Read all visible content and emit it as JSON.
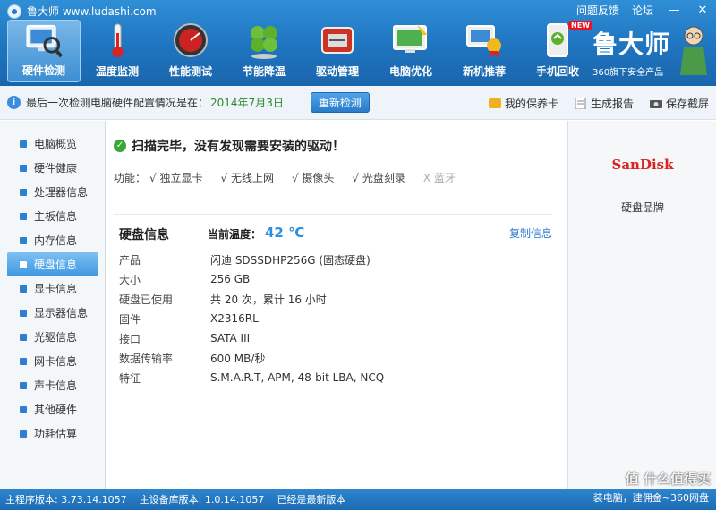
{
  "window": {
    "title": "鲁大师 www.ludashi.com",
    "top_links": [
      "问题反馈",
      "论坛"
    ],
    "min_label": "—",
    "close_label": "✕"
  },
  "toolbar": {
    "items": [
      {
        "label": "硬件检测",
        "icon": "monitor-magnifier-icon"
      },
      {
        "label": "温度监测",
        "icon": "thermometer-icon"
      },
      {
        "label": "性能测试",
        "icon": "speedometer-icon"
      },
      {
        "label": "节能降温",
        "icon": "clover-icon"
      },
      {
        "label": "驱动管理",
        "icon": "driver-chip-icon"
      },
      {
        "label": "电脑优化",
        "icon": "optimize-screen-icon"
      },
      {
        "label": "新机推荐",
        "icon": "new-pc-award-icon"
      },
      {
        "label": "手机回收",
        "icon": "phone-recycle-icon"
      }
    ],
    "new_badge": "NEW"
  },
  "brand": {
    "name": "鲁大师",
    "sub": "360旗下安全产品"
  },
  "infobar": {
    "text": "最后一次检测电脑硬件配置情况是在：",
    "date": "2014年7月3日",
    "redetect_label": "重新检测",
    "actions": [
      "我的保养卡",
      "生成报告",
      "保存截屏"
    ]
  },
  "sidebar": {
    "items": [
      "电脑概览",
      "硬件健康",
      "处理器信息",
      "主板信息",
      "内存信息",
      "硬盘信息",
      "显卡信息",
      "显示器信息",
      "光驱信息",
      "网卡信息",
      "声卡信息",
      "其他硬件",
      "功耗估算"
    ],
    "active_index": 5
  },
  "main": {
    "scan_message": "扫描完毕，没有发现需要安装的驱动！",
    "features_label": "功能：",
    "features": [
      "√ 独立显卡",
      "√ 无线上网",
      "√ 摄像头",
      "√ 光盘刻录",
      "X 蓝牙"
    ],
    "section_title": "硬盘信息",
    "temp_label": "当前温度：",
    "temp_value": "42 ℃",
    "copy_label": "复制信息",
    "rows": [
      {
        "key": "产品",
        "value": "闪迪  SDSSDHP256G (固态硬盘)"
      },
      {
        "key": "大小",
        "value": "256 GB"
      },
      {
        "key": "硬盘已使用",
        "value": "共 20 次，累计 16 小时"
      },
      {
        "key": "固件",
        "value": "X2316RL"
      },
      {
        "key": "接口",
        "value": "SATA III"
      },
      {
        "key": "数据传输率",
        "value": "600 MB/秒"
      },
      {
        "key": "特征",
        "value": "S.M.A.R.T,  APM,  48-bit LBA,  NCQ"
      }
    ]
  },
  "rightpanel": {
    "logo_text": "SanDisk",
    "caption": "硬盘品牌"
  },
  "statusbar": {
    "main_version": "主程序版本: 3.73.14.1057",
    "db_version": "主设备库版本: 1.0.14.1057",
    "latest": "已经是最新版本"
  },
  "watermark": {
    "main": "值 什么值得买",
    "sub": "装电脑，建佣金~360网盘"
  }
}
